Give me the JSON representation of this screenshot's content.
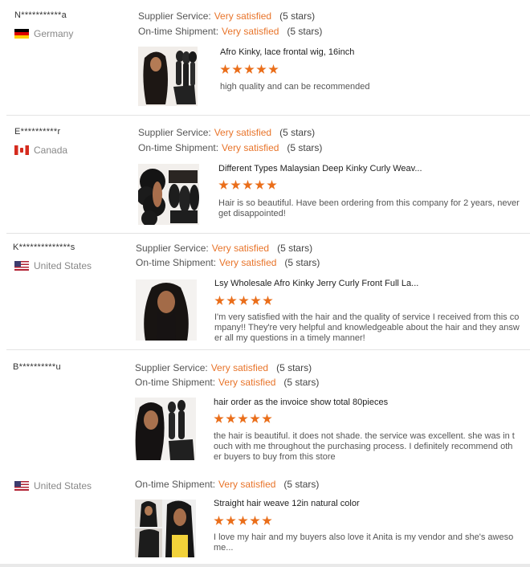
{
  "reviews": [
    {
      "buyer": "N***********a",
      "country": "Germany",
      "flag": "de",
      "supplier_label": "Supplier Service:",
      "supplier_value": "Very satisfied",
      "supplier_stars": "(5 stars)",
      "shipment_label": "On-time Shipment:",
      "shipment_value": "Very satisfied",
      "shipment_stars": "(5 stars)",
      "product_title": "Afro Kinky, lace frontal wig, 16inch",
      "rating": 5,
      "comment": "high quality and can be recommended"
    },
    {
      "buyer": "E**********r",
      "country": "Canada",
      "flag": "ca",
      "supplier_label": "Supplier Service:",
      "supplier_value": "Very satisfied",
      "supplier_stars": "(5 stars)",
      "shipment_label": "On-time Shipment:",
      "shipment_value": "Very satisfied",
      "shipment_stars": "(5 stars)",
      "product_title": "Different Types Malaysian Deep Kinky Curly Weav...",
      "rating": 5,
      "comment": "Hair is so beautiful. Have been ordering from this company for 2 years, never get disappointed!"
    },
    {
      "buyer": "K**************s",
      "country": "United States",
      "flag": "us",
      "supplier_label": "Supplier Service:",
      "supplier_value": "Very satisfied",
      "supplier_stars": "(5 stars)",
      "shipment_label": "On-time Shipment:",
      "shipment_value": "Very satisfied",
      "shipment_stars": "(5 stars)",
      "product_title": "Lsy Wholesale Afro Kinky Jerry Curly Front Full La...",
      "rating": 5,
      "comment": "I'm very satisfied with the hair and the quality of service I received from this company!! They're very helpful and knowledgeable about the hair and they answer all my questions in a timely manner!"
    },
    {
      "buyer": "B**********u",
      "supplier_label": "Supplier Service:",
      "supplier_value": "Very satisfied",
      "supplier_stars": "(5 stars)",
      "shipment_label": "On-time Shipment:",
      "shipment_value": "Very satisfied",
      "shipment_stars": "(5 stars)",
      "product_title": "hair order as the invoice show total 80pieces",
      "rating": 5,
      "comment": "the hair is beautiful. it does not shade. the service was excellent. she was in touch with me throughout the purchasing process. I definitely recommend other buyers to buy from this store"
    },
    {
      "country": "United States",
      "flag": "us",
      "shipment_label": "On-time Shipment:",
      "shipment_value": "Very satisfied",
      "shipment_stars": "(5 stars)",
      "product_title": "Straight hair weave 12in natural color",
      "rating": 5,
      "comment": "I love my hair and my buyers also love it Anita is my vendor and she's awesome..."
    }
  ],
  "colors": {
    "accent_orange": "#e8742a",
    "star_orange": "#ea6e1a"
  }
}
